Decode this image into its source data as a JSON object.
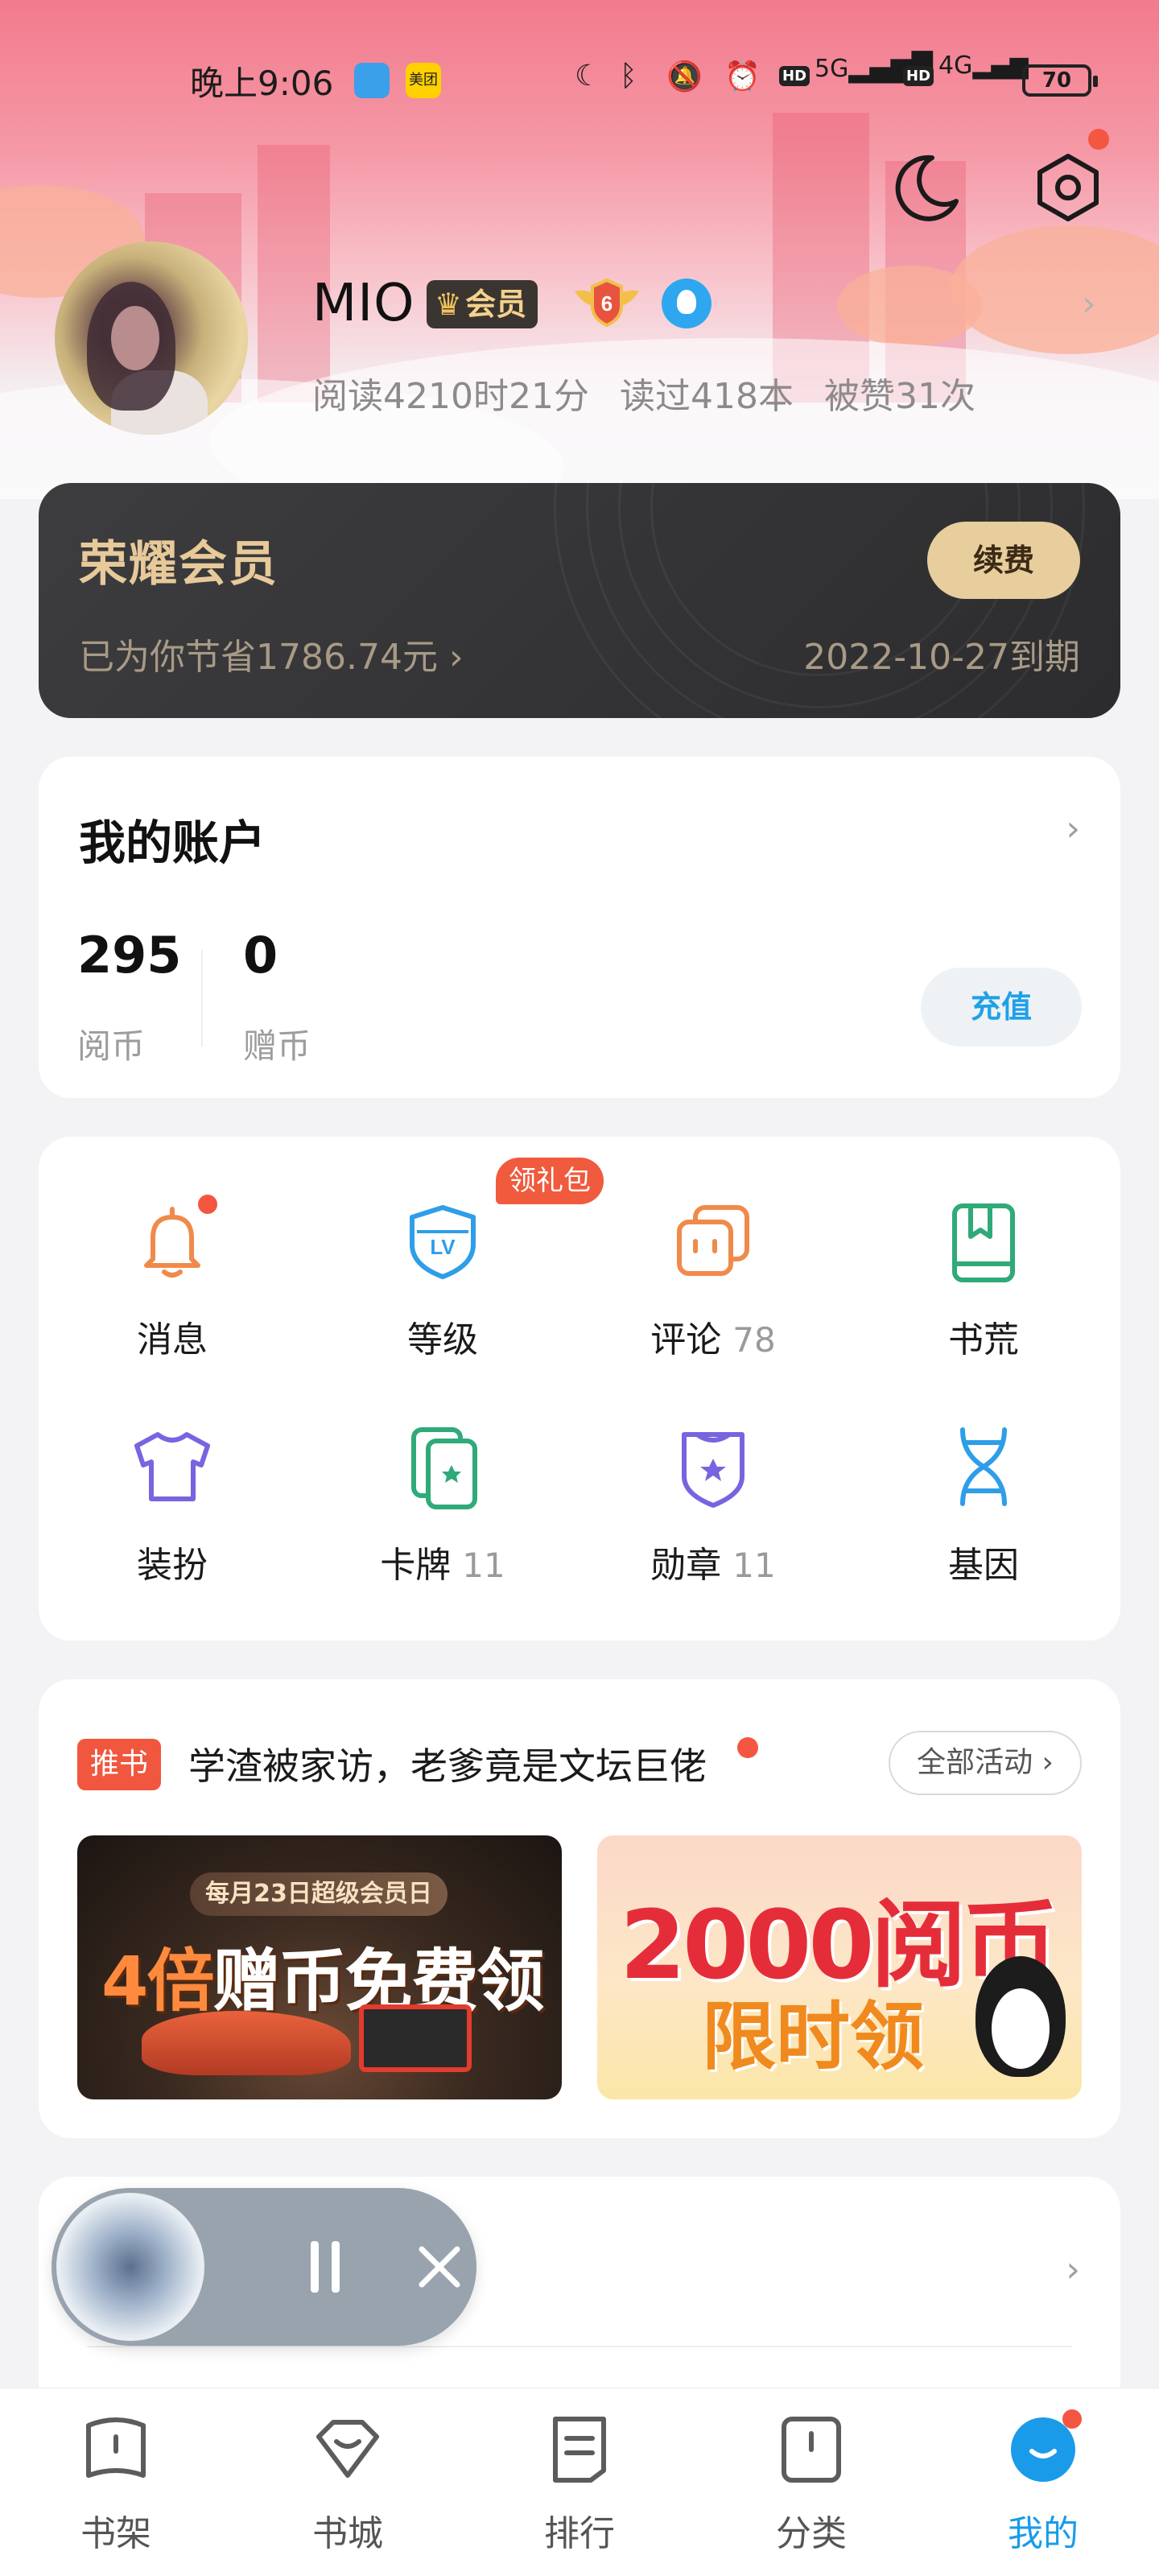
{
  "status_bar": {
    "time": "晚上9:06",
    "app1_label": "",
    "app2_label": "美团",
    "network1": "5G",
    "network2": "4G",
    "battery": "70"
  },
  "profile": {
    "username": "MIO",
    "member_badge": "会员",
    "level": "6",
    "stats": [
      "阅读4210时21分",
      "读过418本",
      "被赞31次"
    ]
  },
  "vip_card": {
    "title": "荣耀会员",
    "savings": "已为你节省1786.74元",
    "expire": "2022-10-27到期",
    "renew_label": "续费"
  },
  "account": {
    "title": "我的账户",
    "balances": [
      {
        "value": "295",
        "label": "阅币"
      },
      {
        "value": "0",
        "label": "赠币"
      }
    ],
    "recharge_label": "充值"
  },
  "grid": {
    "gift_tag": "领礼包",
    "items": [
      {
        "label": "消息",
        "count": "",
        "icon": "bell-icon",
        "color": "#f08a4b"
      },
      {
        "label": "等级",
        "count": "",
        "icon": "level-shield-icon",
        "color": "#2f9ee8"
      },
      {
        "label": "评论",
        "count": "78",
        "icon": "comment-icon",
        "color": "#f08a4b"
      },
      {
        "label": "书荒",
        "count": "",
        "icon": "bookmark-book-icon",
        "color": "#2faa78"
      },
      {
        "label": "装扮",
        "count": "",
        "icon": "tshirt-icon",
        "color": "#7a63e0"
      },
      {
        "label": "卡牌",
        "count": "11",
        "icon": "card-icon",
        "color": "#2faa78"
      },
      {
        "label": "勋章",
        "count": "11",
        "icon": "medal-icon",
        "color": "#7a63e0"
      },
      {
        "label": "基因",
        "count": "",
        "icon": "dna-icon",
        "color": "#2f9ee8"
      }
    ]
  },
  "promo": {
    "tag": "推书",
    "text": "学渣被家访，老爹竟是文坛巨佬",
    "all_activity_label": "全部活动",
    "banner_left": {
      "pill": "每月23日超级会员日",
      "headline_a": "4倍",
      "headline_b": "赠币免费领"
    },
    "banner_right": {
      "headline_a": "2000阅币",
      "headline_b": "限时领"
    }
  },
  "bottom_nav": {
    "items": [
      {
        "label": "书架",
        "icon": "bookshelf-icon"
      },
      {
        "label": "书城",
        "icon": "bookstore-icon"
      },
      {
        "label": "排行",
        "icon": "ranking-icon"
      },
      {
        "label": "分类",
        "icon": "category-icon"
      },
      {
        "label": "我的",
        "icon": "profile-icon"
      }
    ],
    "active_index": 4
  },
  "colors": {
    "accent": "#1a9bea",
    "header_pink": "#f27b8d",
    "gold": "#e7c99a",
    "badge_red": "#f05a3d"
  }
}
